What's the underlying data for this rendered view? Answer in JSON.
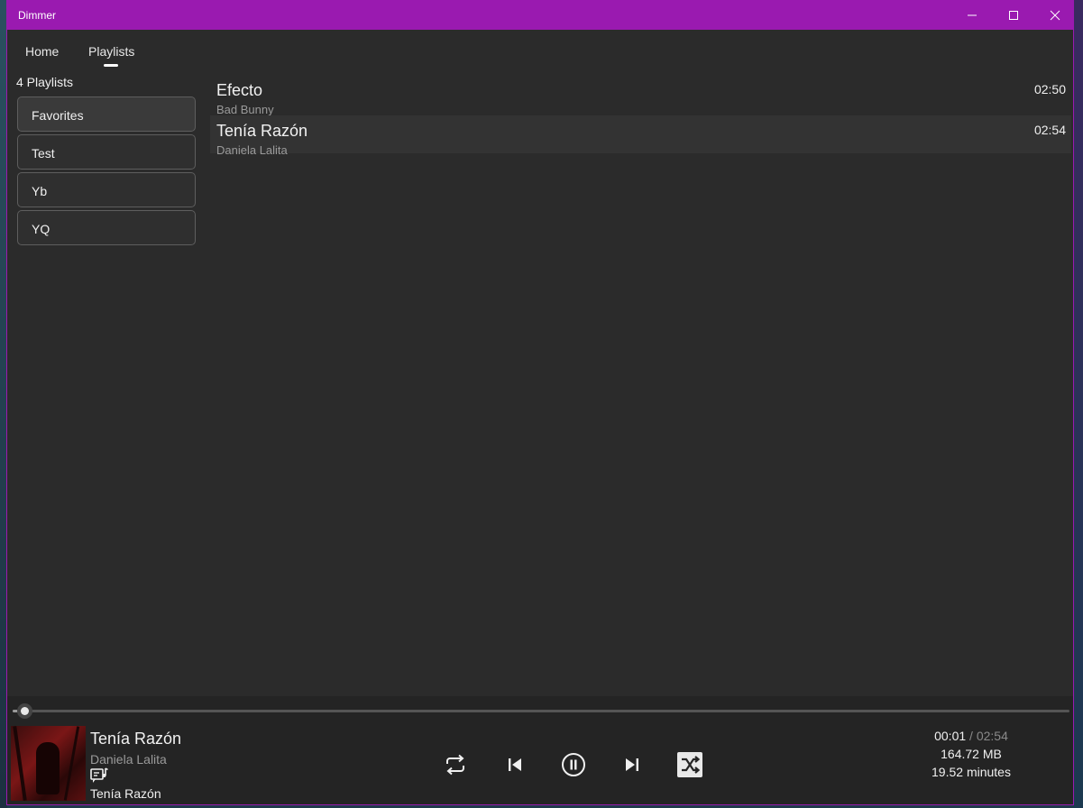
{
  "window": {
    "title": "Dimmer"
  },
  "nav": {
    "home_label": "Home",
    "playlists_label": "Playlists",
    "active_tab": "Playlists"
  },
  "sidebar": {
    "count_label": "4 Playlists",
    "items": [
      {
        "label": "Favorites",
        "selected": true
      },
      {
        "label": "Test"
      },
      {
        "label": "Yb"
      },
      {
        "label": "YQ"
      }
    ]
  },
  "songs": [
    {
      "title": "Efecto",
      "artist": "Bad Bunny",
      "duration": "02:50"
    },
    {
      "title": "Tenía Razón",
      "artist": "Daniela Lalita",
      "duration": "02:54",
      "active": true
    }
  ],
  "player": {
    "title": "Tenía Razón",
    "artist": "Daniela Lalita",
    "album": "Tenía Razón",
    "elapsed": "00:01",
    "total": "/ 02:54",
    "progress_fraction": 0.006,
    "file_size": "164.72 MB",
    "playlist_minutes": "19.52 minutes",
    "controls": [
      "repeat-icon",
      "previous-icon",
      "pause-icon",
      "next-icon",
      "shuffle-icon"
    ]
  },
  "colors": {
    "accent": "#9a1ab0",
    "background": "#2b2b2b",
    "player_bg": "#242424"
  }
}
